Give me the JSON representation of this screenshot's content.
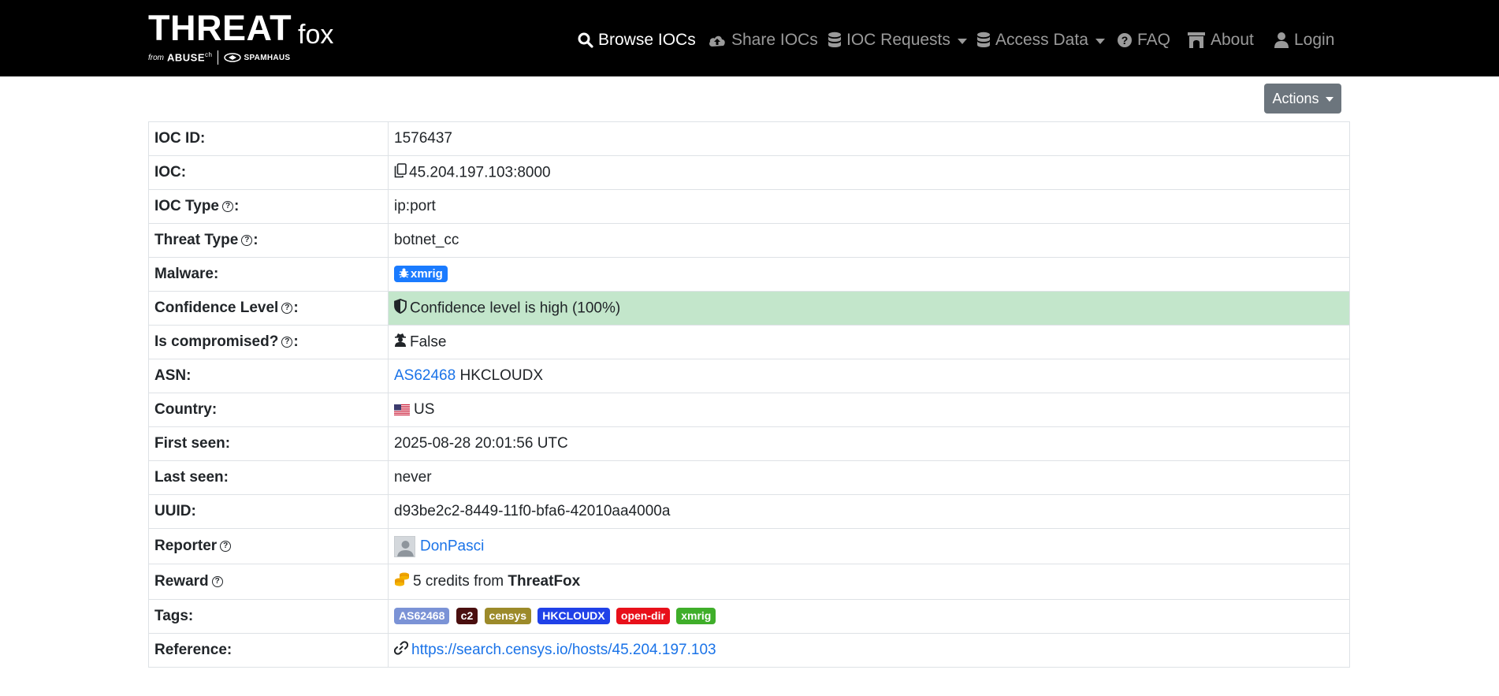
{
  "brand": {
    "main": "THREAT",
    "fox": "fox",
    "from": "from",
    "abuse": "ABUSE",
    "abuse_sup": "ch",
    "spamhaus": "SPAMHAUS"
  },
  "nav": {
    "browse": "Browse IOCs",
    "share": "Share IOCs",
    "requests": "IOC Requests",
    "access": "Access Data",
    "faq": "FAQ",
    "about": "About",
    "login": "Login"
  },
  "actions_label": "Actions",
  "details": {
    "ioc_id": {
      "label": "IOC ID:",
      "value": "1576437"
    },
    "ioc": {
      "label": "IOC:",
      "value": "45.204.197.103:8000"
    },
    "ioc_type": {
      "label": "IOC Type",
      "suffix": ":",
      "value": "ip:port"
    },
    "threat_type": {
      "label": "Threat Type",
      "suffix": ":",
      "value": "botnet_cc"
    },
    "malware": {
      "label": "Malware:",
      "value": "xmrig"
    },
    "confidence": {
      "label": "Confidence Level",
      "suffix": ":",
      "value": "Confidence level is high (100%)"
    },
    "compromised": {
      "label": "Is compromised?",
      "suffix": ":",
      "value": "False"
    },
    "asn": {
      "label": "ASN:",
      "link": "AS62468",
      "name": "HKCLOUDX"
    },
    "country": {
      "label": "Country:",
      "value": "US"
    },
    "first_seen": {
      "label": "First seen:",
      "value": "2025-08-28 20:01:56 UTC"
    },
    "last_seen": {
      "label": "Last seen:",
      "value": "never"
    },
    "uuid": {
      "label": "UUID:",
      "value": "d93be2c2-8449-11f0-bfa6-42010aa4000a"
    },
    "reporter": {
      "label": "Reporter",
      "value": "DonPasci"
    },
    "reward": {
      "label": "Reward",
      "value": "5 credits from",
      "from": "ThreatFox"
    },
    "tags": {
      "label": "Tags:",
      "items": [
        {
          "text": "AS62468",
          "color": "#7b93d6"
        },
        {
          "text": "c2",
          "color": "#4a0f0f"
        },
        {
          "text": "censys",
          "color": "#9c8a2a"
        },
        {
          "text": "HKCLOUDX",
          "color": "#2041e8"
        },
        {
          "text": "open-dir",
          "color": "#e8101a"
        },
        {
          "text": "xmrig",
          "color": "#3fae2a"
        }
      ]
    },
    "reference": {
      "label": "Reference:",
      "value": "https://search.censys.io/hosts/45.204.197.103"
    }
  },
  "colors": {
    "navbar": "#000000",
    "link": "#1a73e8",
    "success_row": "#c3e6cb",
    "actions_button": "#6c757d"
  }
}
